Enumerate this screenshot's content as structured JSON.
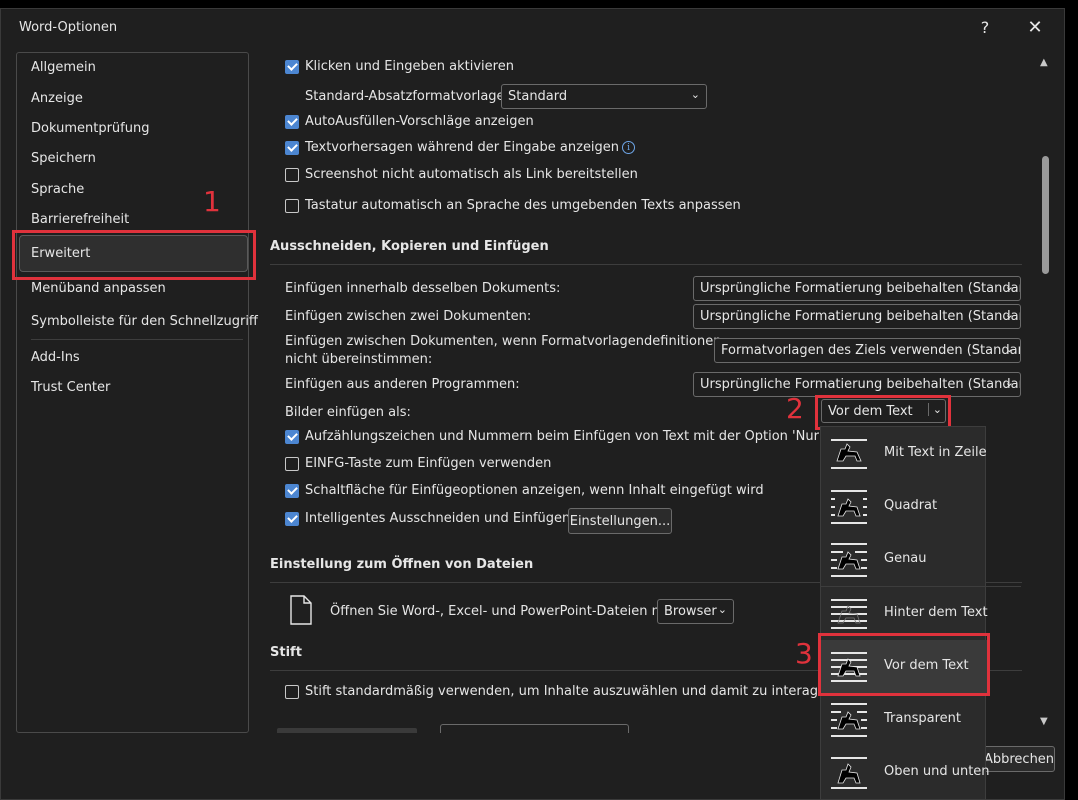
{
  "window": {
    "title": "Word-Optionen",
    "help": "?",
    "close": "✕"
  },
  "sidebar": {
    "items": [
      {
        "label": "Allgemein"
      },
      {
        "label": "Anzeige"
      },
      {
        "label": "Dokumentprüfung"
      },
      {
        "label": "Speichern"
      },
      {
        "label": "Sprache"
      },
      {
        "label": "Barrierefreiheit"
      },
      {
        "label": "Erweitert",
        "selected": true
      },
      {
        "label": "Menüband anpassen"
      },
      {
        "label": "Symbolleiste für den Schnellzugriff"
      },
      {
        "label": "Add-Ins"
      },
      {
        "label": "Trust Center"
      }
    ]
  },
  "callouts": {
    "one": "1",
    "two": "2",
    "three": "3"
  },
  "editing": {
    "click_and_type": {
      "label": "Klicken und Eingeben aktivieren",
      "checked": true
    },
    "default_style_label": "Standard-Absatzformatvorlage:",
    "default_style_value": "Standard",
    "autofill": {
      "label": "AutoAusfüllen-Vorschläge anzeigen",
      "checked": true
    },
    "text_predictions": {
      "label": "Textvorhersagen während der Eingabe anzeigen",
      "checked": true
    },
    "screenshot_link": {
      "label": "Screenshot nicht automatisch als Link bereitstellen",
      "checked": false
    },
    "keyboard_lang": {
      "label": "Tastatur automatisch an Sprache des umgebenden Texts anpassen",
      "checked": false
    }
  },
  "cut_copy_paste": {
    "heading": "Ausschneiden, Kopieren und Einfügen",
    "within_doc": {
      "label": "Einfügen innerhalb desselben Dokuments:",
      "value": "Ursprüngliche Formatierung beibehalten (Standard)"
    },
    "between_docs": {
      "label": "Einfügen zwischen zwei Dokumenten:",
      "value": "Ursprüngliche Formatierung beibehalten (Standard)"
    },
    "between_docs_conflict": {
      "label_line1": "Einfügen zwischen Dokumenten, wenn Formatvorlagendefinitionen",
      "label_line2": "nicht übereinstimmen:",
      "value": "Formatvorlagen des Ziels verwenden (Standard)"
    },
    "other_programs": {
      "label": "Einfügen aus anderen Programmen:",
      "value": "Ursprüngliche Formatierung beibehalten (Standard)"
    },
    "pictures": {
      "label": "Bilder einfügen als:",
      "value": "Vor dem Text"
    },
    "bullets": {
      "label": "Aufzählungszeichen und Nummern beim Einfügen von Text mit der Option 'Nur den Text",
      "checked": true
    },
    "insert_key": {
      "label": "EINFG-Taste zum Einfügen verwenden",
      "checked": false
    },
    "paste_options_button": {
      "label": "Schaltfläche für Einfügeoptionen anzeigen, wenn Inhalt eingefügt wird",
      "checked": true
    },
    "smart_cut": {
      "label": "Intelligentes Ausschneiden und Einfügen",
      "checked": true
    },
    "settings_button": "Einstellungen..."
  },
  "open_files": {
    "heading": "Einstellung zum Öffnen von Dateien",
    "label": "Öffnen Sie Word-, Excel- und PowerPoint-Dateien mit:",
    "value": "Browser"
  },
  "pen": {
    "heading": "Stift",
    "default_pen": {
      "label": "Stift standardmäßig verwenden, um Inhalte auszuwählen und damit zu interagieren",
      "checked": false
    }
  },
  "picture_popup": {
    "items": [
      {
        "label": "Mit Text in Zeile",
        "icon": "inline-icon"
      },
      {
        "label": "Quadrat",
        "icon": "square-wrap-icon"
      },
      {
        "label": "Genau",
        "icon": "tight-wrap-icon"
      },
      {
        "label": "Hinter dem Text",
        "icon": "behind-text-icon"
      },
      {
        "label": "Vor dem Text",
        "icon": "in-front-text-icon",
        "selected": true
      },
      {
        "label": "Transparent",
        "icon": "through-wrap-icon"
      },
      {
        "label": "Oben und unten",
        "icon": "top-bottom-icon"
      }
    ]
  },
  "footer": {
    "cancel": "Abbrechen"
  },
  "colors": {
    "accent": "#4c86d1",
    "highlight": "#e0323c",
    "background": "#1f1f1f"
  }
}
